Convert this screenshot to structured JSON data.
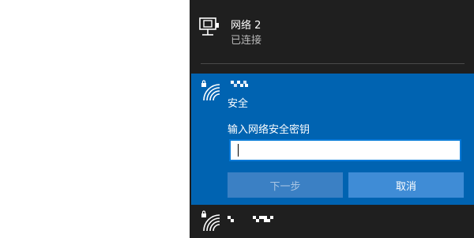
{
  "wired": {
    "name": "网络 2",
    "status": "已连接"
  },
  "selected_network": {
    "status": "安全",
    "prompt": "输入网络安全密钥",
    "key_value": "",
    "next_label": "下一步",
    "cancel_label": "取消"
  },
  "icons": {
    "wired": "ethernet-icon",
    "wifi": "wifi-secured-icon"
  },
  "colors": {
    "flyout_bg": "#1f1f1f",
    "selected_bg": "#0063b1",
    "input_border": "#0078d7"
  }
}
